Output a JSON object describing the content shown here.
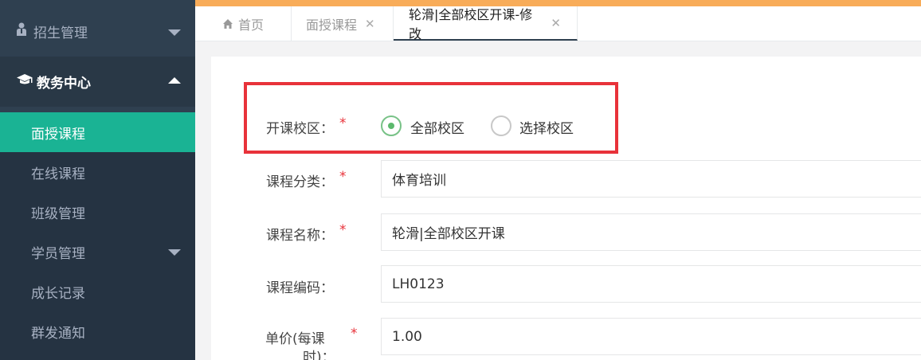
{
  "sidebar": {
    "recruit": {
      "label": "招生管理",
      "icon": "user-icon"
    },
    "academic": {
      "label": "教务中心",
      "icon": "graduation-cap-icon"
    },
    "items": [
      {
        "label": "面授课程"
      },
      {
        "label": "在线课程"
      },
      {
        "label": "班级管理"
      },
      {
        "label": "学员管理"
      },
      {
        "label": "成长记录"
      },
      {
        "label": "群发通知"
      }
    ]
  },
  "tabs": [
    {
      "label": "首页"
    },
    {
      "label": "面授课程"
    },
    {
      "label": "轮滑|全部校区开课-修改"
    }
  ],
  "form": {
    "campus": {
      "label": "开课校区：",
      "required": "*",
      "options": [
        {
          "label": "全部校区",
          "checked": true
        },
        {
          "label": "选择校区",
          "checked": false
        }
      ]
    },
    "category": {
      "label": "课程分类：",
      "required": "*",
      "value": "体育培训"
    },
    "name": {
      "label": "课程名称：",
      "required": "*",
      "value": "轮滑|全部校区开课"
    },
    "code": {
      "label": "课程编码：",
      "value": "LH0123"
    },
    "price": {
      "label_line1": "单价(每课",
      "label_line2": "时)：",
      "required": "*",
      "value": "1.00"
    }
  },
  "colors": {
    "sidebar": "#2f4050",
    "active": "#1ab394",
    "accent_strip": "#f8ac59",
    "highlight": "#e8323a",
    "radio_checked": "#5cb96d"
  }
}
